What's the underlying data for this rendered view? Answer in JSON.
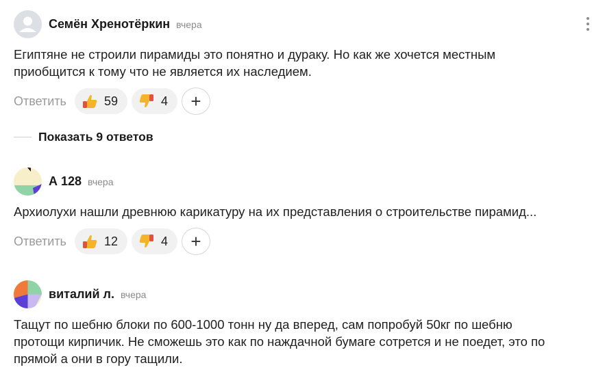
{
  "comments": [
    {
      "author": "Семён Хренотёркин",
      "time": "вчера",
      "text": "Египтяне не строили пирамиды это понятно и дураку. Но как же хочется местным\nприобщится к тому что не является их наследием.",
      "reply_label": "Ответить",
      "likes": "59",
      "dislikes": "4",
      "avatar_icon": "default-user-avatar"
    },
    {
      "author": "А 128",
      "time": "вчера",
      "text": "Архиолухи нашли древнюю карикатуру на их представления о строительстве пирамид...",
      "reply_label": "Ответить",
      "likes": "12",
      "dislikes": "4",
      "avatar_icon": "geometric-avatar"
    },
    {
      "author": "виталий л.",
      "time": "вчера",
      "text": "Тащут по шебню блоки по 600-1000 тонн ну да вперед, сам попробуй 50кг по шебню\nпротощи кирпичик. Не сможешь это как по наждачной бумаге сотрется и не поедет, это по\nпрямой а они в гору тащили.",
      "avatar_icon": "geometric-avatar"
    }
  ],
  "show_replies": "Показать 9 ответов",
  "plus_label": "+",
  "colors": {
    "muted_text": "#8a8a8a",
    "pill_bg": "#f1f1f1",
    "thumb": "#f5b32a",
    "thumb_sleeve": "#e0523d"
  }
}
